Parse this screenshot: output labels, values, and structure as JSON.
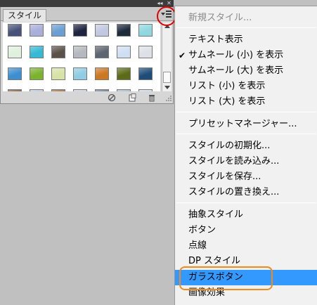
{
  "panel": {
    "tab_label": "スタイル",
    "swatch_colors": [
      [
        "#46527a",
        "#a9aedb",
        "#6b9fd3",
        "#1e2540",
        "#c2c8df",
        "#1d2a3c",
        "#8fd8e0"
      ],
      [
        "#dff1dd",
        "#35b9d4",
        "#5a5249",
        "#b4b8bf",
        "#5c6570",
        "#cfdff2",
        "#dde1e7"
      ],
      [
        "#3d8fd0",
        "#7cb32c",
        "#d7e2a6",
        "#90cce3",
        "#cc7722",
        "#5c6b16",
        "#1f4d7a"
      ],
      [
        "#7a5a3a",
        "#b8c8d8",
        "#9a6b3a",
        "#c8d0d8",
        "#6a7a8a",
        "#a8b8c8",
        "#d0d8e0"
      ]
    ]
  },
  "menu": {
    "items": [
      {
        "label": "新規スタイル...",
        "disabled": true,
        "checked": false
      },
      {
        "label": "テキスト表示",
        "disabled": false,
        "checked": false
      },
      {
        "label": "サムネール (小) を表示",
        "disabled": false,
        "checked": true
      },
      {
        "label": "サムネール (大) を表示",
        "disabled": false,
        "checked": false
      },
      {
        "label": "リスト (小) を表示",
        "disabled": false,
        "checked": false
      },
      {
        "label": "リスト (大) を表示",
        "disabled": false,
        "checked": false
      },
      {
        "label": "プリセットマネージャー...",
        "disabled": false,
        "checked": false
      },
      {
        "label": "スタイルの初期化...",
        "disabled": false,
        "checked": false
      },
      {
        "label": "スタイルを読み込み...",
        "disabled": false,
        "checked": false
      },
      {
        "label": "スタイルを保存...",
        "disabled": false,
        "checked": false
      },
      {
        "label": "スタイルの置き換え...",
        "disabled": false,
        "checked": false
      },
      {
        "label": "抽象スタイル",
        "disabled": false,
        "checked": false
      },
      {
        "label": "ボタン",
        "disabled": false,
        "checked": false
      },
      {
        "label": "点線",
        "disabled": false,
        "checked": false
      },
      {
        "label": "DP スタイル",
        "disabled": false,
        "checked": false
      },
      {
        "label": "ガラスボタン",
        "disabled": false,
        "checked": false,
        "highlighted": true
      },
      {
        "label": "画像効果",
        "disabled": false,
        "checked": false
      }
    ],
    "check_glyph": "✔"
  },
  "colors": {
    "highlight": "#3399ff",
    "annotation_red": "#e00000",
    "annotation_orange": "#f08a1c"
  },
  "icons": [
    "collapse-icon",
    "close-icon",
    "panel-menu-icon",
    "clear-style-icon",
    "new-style-icon",
    "trash-icon",
    "resize-grip-icon"
  ]
}
